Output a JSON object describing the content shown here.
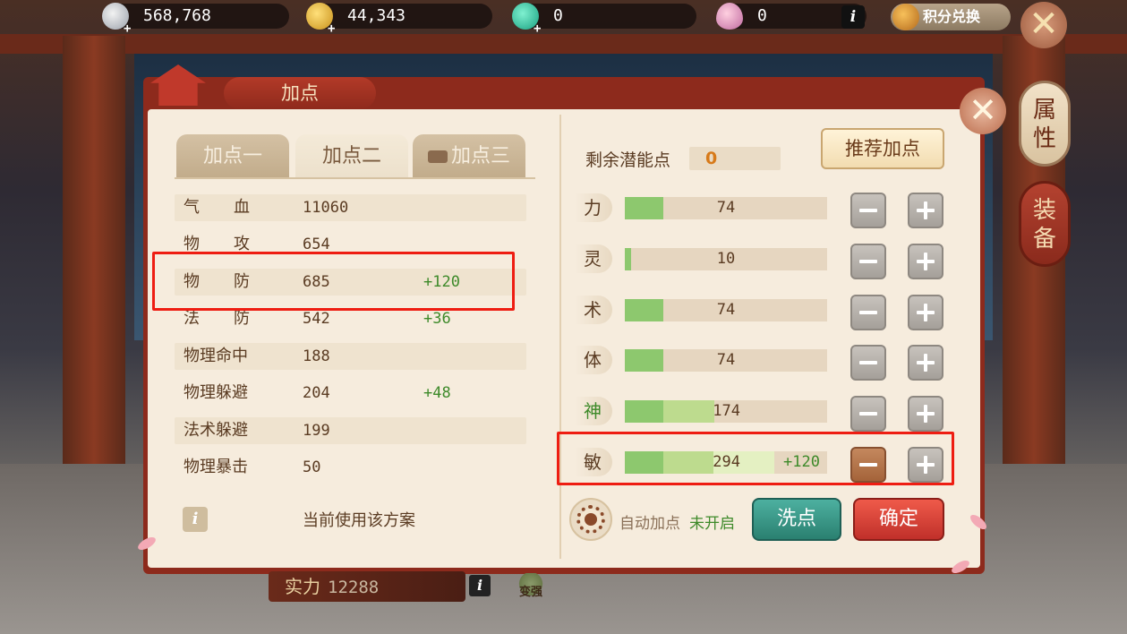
{
  "topbar": {
    "silver": "568,768",
    "gold": "44,343",
    "jade": "0",
    "gem": "0",
    "info_label": "i",
    "exchange_label": "积分兑换",
    "close_label": "✕"
  },
  "side_tabs": [
    "属性",
    "装备"
  ],
  "panel": {
    "title": "加点",
    "close_label": "✕",
    "tabs": [
      "加点一",
      "加点二",
      "加点三"
    ],
    "active_tab": 1,
    "stats": [
      {
        "label": "气血",
        "value": "11060",
        "bonus": ""
      },
      {
        "label": "物攻",
        "value": "654",
        "bonus": ""
      },
      {
        "label": "物防",
        "value": "685",
        "bonus": "+120"
      },
      {
        "label": "法防",
        "value": "542",
        "bonus": "+36"
      },
      {
        "label": "物理命中",
        "value": "188",
        "bonus": ""
      },
      {
        "label": "物理躲避",
        "value": "204",
        "bonus": "+48"
      },
      {
        "label": "法术躲避",
        "value": "199",
        "bonus": ""
      },
      {
        "label": "物理暴击",
        "value": "50",
        "bonus": ""
      }
    ],
    "info_label": "i",
    "scheme_note": "当前使用该方案",
    "potential_label": "剩余潜能点",
    "potential_value": "0",
    "recommend_label": "推荐加点",
    "attributes": [
      {
        "label": "力",
        "value": "74",
        "bonus": "",
        "base_fraction": 0.19,
        "mid_fraction": 0,
        "bonus_fraction": 0,
        "label_green": false,
        "minus_active": false
      },
      {
        "label": "灵",
        "value": "10",
        "bonus": "",
        "base_fraction": 0.03,
        "mid_fraction": 0,
        "bonus_fraction": 0,
        "label_green": false,
        "minus_active": false
      },
      {
        "label": "术",
        "value": "74",
        "bonus": "",
        "base_fraction": 0.19,
        "mid_fraction": 0,
        "bonus_fraction": 0,
        "label_green": false,
        "minus_active": false
      },
      {
        "label": "体",
        "value": "74",
        "bonus": "",
        "base_fraction": 0.19,
        "mid_fraction": 0,
        "bonus_fraction": 0,
        "label_green": false,
        "minus_active": false
      },
      {
        "label": "神",
        "value": "174",
        "bonus": "",
        "base_fraction": 0.19,
        "mid_fraction": 0.25,
        "bonus_fraction": 0,
        "label_green": true,
        "minus_active": false
      },
      {
        "label": "敏",
        "value": "294",
        "bonus": "+120",
        "base_fraction": 0.19,
        "mid_fraction": 0.25,
        "bonus_fraction": 0.3,
        "label_green": false,
        "minus_active": true
      }
    ],
    "auto_label": "自动加点",
    "auto_state": "未开启",
    "wash_label": "洗点",
    "confirm_label": "确定"
  },
  "bottom": {
    "power_label": "实力",
    "power_value": "12288",
    "info_label": "i",
    "strengthen_label": "变强"
  },
  "colors": {
    "highlight": "#ee1d12",
    "bonus_green": "#3e8a2a",
    "confirm_red": "#c0302a",
    "wash_teal": "#2a8070"
  }
}
